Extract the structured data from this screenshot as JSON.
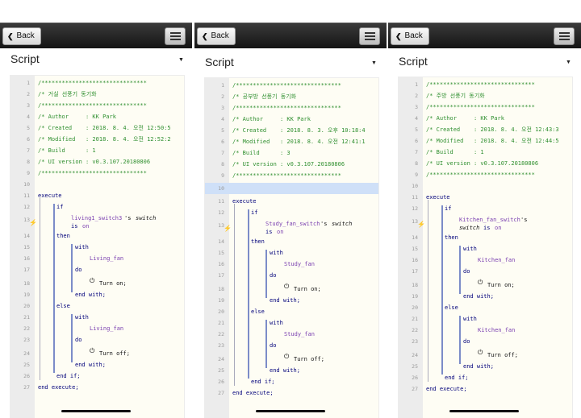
{
  "back_label": "Back",
  "script_label": "Script",
  "panels": [
    {
      "header": [
        "/*******************************",
        "/* 거실 선풍기 동기화",
        "/*******************************"
      ],
      "author": "/* Author     : KK Park",
      "created": "/* Created    : 2018. 8. 4. 오전 12:50:5",
      "modified": "/* Modified   : 2018. 8. 4. 오전 12:52:2",
      "build": "/* Build      : 1",
      "uiver": "/* UI version : v0.3.107.20180806",
      "cond_name": "living1_switch3",
      "device": "Living_fan"
    },
    {
      "header": [
        "/*******************************",
        "/* 공부방 선풍기 동기화",
        "/*******************************"
      ],
      "author": "/* Author     : KK Park",
      "created": "/* Created    : 2018. 8. 3. 오후 10:18:4",
      "modified": "/* Modified   : 2018. 8. 4. 오전 12:41:1",
      "build": "/* Build      : 3",
      "uiver": "/* UI version : v0.3.107.20180806",
      "cond_name": "Study_fan_switch",
      "device": "Study_fan"
    },
    {
      "header": [
        "/*******************************",
        "/* 주방 선풍기 동기화",
        "/*******************************"
      ],
      "author": "/* Author     : KK Park",
      "created": "/* Created    : 2018. 8. 4. 오전 12:43:3",
      "modified": "/* Modified   : 2018. 8. 4. 오전 12:44:5",
      "build": "/* Build      : 1",
      "uiver": "/* UI version : v0.3.107.20180806",
      "cond_name": "Kitchen_fan_switch",
      "device": "Kitchen_fan"
    }
  ],
  "kw": {
    "execute": "execute",
    "if": "if",
    "then": "then",
    "with": "with",
    "do": "do",
    "else": "else",
    "end_with": "end with;",
    "end_if": "end if;",
    "end_execute": "end execute;",
    "is": "is",
    "on": "on",
    "poss": "'s",
    "switch": "switch",
    "turn_on": "Turn on;",
    "turn_off": "Turn off;"
  },
  "line_numbers": [
    "1",
    "2",
    "3",
    "4",
    "5",
    "6",
    "7",
    "8",
    "9",
    "10",
    "11",
    "12",
    "13",
    "14",
    "15",
    "16",
    "17",
    "18",
    "19",
    "20",
    "21",
    "22",
    "23",
    "24",
    "25",
    "26",
    "27"
  ]
}
